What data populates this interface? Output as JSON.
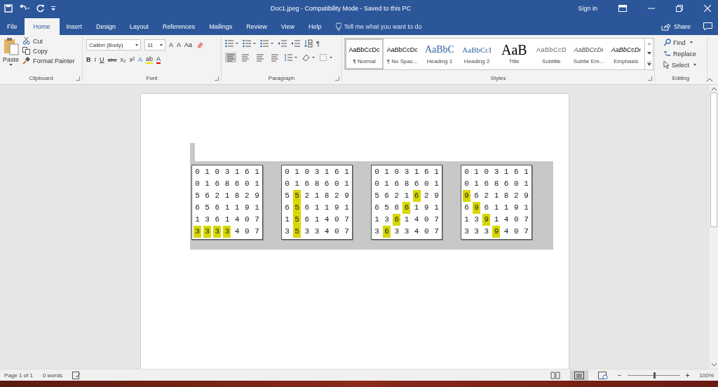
{
  "window": {
    "title": "Doc1.jpeg  -  Compatibility Mode  -  Saved to this PC",
    "sign_in": "Sign in"
  },
  "tabs": [
    {
      "label": "File",
      "selected": false
    },
    {
      "label": "Home",
      "selected": true
    },
    {
      "label": "Insert",
      "selected": false
    },
    {
      "label": "Design",
      "selected": false
    },
    {
      "label": "Layout",
      "selected": false
    },
    {
      "label": "References",
      "selected": false
    },
    {
      "label": "Mailings",
      "selected": false
    },
    {
      "label": "Review",
      "selected": false
    },
    {
      "label": "View",
      "selected": false
    },
    {
      "label": "Help",
      "selected": false
    }
  ],
  "tell_me": {
    "placeholder": "Tell me what you want to do"
  },
  "share": "Share",
  "clipboard": {
    "paste": "Paste",
    "items": [
      "Cut",
      "Copy",
      "Format Painter"
    ],
    "label": "Clipboard"
  },
  "font": {
    "family": "Calibri (Body)",
    "size": "11",
    "row1": [
      "A",
      "A",
      "Aa"
    ],
    "row2": [
      "B",
      "I",
      "U",
      "abc",
      "x₂",
      "x²",
      "A",
      "ab",
      "A"
    ],
    "label": "Font"
  },
  "paragraph": {
    "pilcrow": "¶",
    "label": "Paragraph"
  },
  "styles": {
    "label": "Styles",
    "items": [
      {
        "preview": "AaBbCcDc",
        "name": "¶ Normal",
        "kind": "body",
        "selected": true
      },
      {
        "preview": "AaBbCcDc",
        "name": "¶ No Spac...",
        "kind": "body",
        "selected": false
      },
      {
        "preview": "AaBbC",
        "name": "Heading 1",
        "kind": "heading1",
        "selected": false
      },
      {
        "preview": "AaBbCcI",
        "name": "Heading 2",
        "kind": "heading2",
        "selected": false
      },
      {
        "preview": "AaB",
        "name": "Title",
        "kind": "title",
        "selected": false
      },
      {
        "preview": "AaBbCcD",
        "name": "Subtitle",
        "kind": "subtitle",
        "selected": false
      },
      {
        "preview": "AaBbCcDı",
        "name": "Subtle Em...",
        "kind": "subtle",
        "selected": false
      },
      {
        "preview": "AaBbCcDı",
        "name": "Emphasis",
        "kind": "emphasis",
        "selected": false
      }
    ]
  },
  "editing": {
    "items": [
      "Find",
      "Replace",
      "Select"
    ],
    "label": "Editing"
  },
  "grids": [
    {
      "rows": [
        {
          "cells": [
            "0",
            "1",
            "0",
            "3",
            "1",
            "6",
            "1"
          ],
          "highlighted": [
            false,
            false,
            false,
            false,
            false,
            false,
            false
          ]
        },
        {
          "cells": [
            "0",
            "1",
            "6",
            "8",
            "6",
            "0",
            "1"
          ],
          "highlighted": [
            false,
            false,
            false,
            false,
            false,
            false,
            false
          ]
        },
        {
          "cells": [
            "5",
            "6",
            "2",
            "1",
            "8",
            "2",
            "9"
          ],
          "highlighted": [
            false,
            false,
            false,
            false,
            false,
            false,
            false
          ]
        },
        {
          "cells": [
            "6",
            "5",
            "6",
            "1",
            "1",
            "9",
            "1"
          ],
          "highlighted": [
            false,
            false,
            false,
            false,
            false,
            false,
            false
          ]
        },
        {
          "cells": [
            "1",
            "3",
            "6",
            "1",
            "4",
            "0",
            "7"
          ],
          "highlighted": [
            false,
            false,
            false,
            false,
            false,
            false,
            false
          ]
        },
        {
          "cells": [
            "3",
            "3",
            "3",
            "3",
            "4",
            "0",
            "7"
          ],
          "highlighted": [
            true,
            true,
            true,
            true,
            false,
            false,
            false
          ]
        }
      ]
    },
    {
      "rows": [
        {
          "cells": [
            "0",
            "1",
            "0",
            "3",
            "1",
            "6",
            "1"
          ],
          "highlighted": [
            false,
            false,
            false,
            false,
            false,
            false,
            false
          ]
        },
        {
          "cells": [
            "0",
            "1",
            "6",
            "8",
            "6",
            "0",
            "1"
          ],
          "highlighted": [
            false,
            false,
            false,
            false,
            false,
            false,
            false
          ]
        },
        {
          "cells": [
            "5",
            "5",
            "2",
            "1",
            "8",
            "2",
            "9"
          ],
          "highlighted": [
            false,
            true,
            false,
            false,
            false,
            false,
            false
          ]
        },
        {
          "cells": [
            "6",
            "5",
            "6",
            "1",
            "1",
            "9",
            "1"
          ],
          "highlighted": [
            false,
            true,
            false,
            false,
            false,
            false,
            false
          ]
        },
        {
          "cells": [
            "1",
            "5",
            "6",
            "1",
            "4",
            "0",
            "7"
          ],
          "highlighted": [
            false,
            true,
            false,
            false,
            false,
            false,
            false
          ]
        },
        {
          "cells": [
            "3",
            "5",
            "3",
            "3",
            "4",
            "0",
            "7"
          ],
          "highlighted": [
            false,
            true,
            false,
            false,
            false,
            false,
            false
          ]
        }
      ]
    },
    {
      "rows": [
        {
          "cells": [
            "0",
            "1",
            "0",
            "3",
            "1",
            "6",
            "1"
          ],
          "highlighted": [
            false,
            false,
            false,
            false,
            false,
            false,
            false
          ]
        },
        {
          "cells": [
            "0",
            "1",
            "6",
            "8",
            "6",
            "0",
            "1"
          ],
          "highlighted": [
            false,
            false,
            false,
            false,
            false,
            false,
            false
          ]
        },
        {
          "cells": [
            "5",
            "6",
            "2",
            "1",
            "6",
            "2",
            "9"
          ],
          "highlighted": [
            false,
            false,
            false,
            false,
            true,
            false,
            false
          ]
        },
        {
          "cells": [
            "6",
            "5",
            "6",
            "6",
            "1",
            "9",
            "1"
          ],
          "highlighted": [
            false,
            false,
            false,
            true,
            false,
            false,
            false
          ]
        },
        {
          "cells": [
            "1",
            "3",
            "6",
            "1",
            "4",
            "0",
            "7"
          ],
          "highlighted": [
            false,
            false,
            true,
            false,
            false,
            false,
            false
          ]
        },
        {
          "cells": [
            "3",
            "6",
            "3",
            "3",
            "4",
            "0",
            "7"
          ],
          "highlighted": [
            false,
            true,
            false,
            false,
            false,
            false,
            false
          ]
        }
      ]
    },
    {
      "rows": [
        {
          "cells": [
            "0",
            "1",
            "0",
            "3",
            "1",
            "6",
            "1"
          ],
          "highlighted": [
            false,
            false,
            false,
            false,
            false,
            false,
            false
          ]
        },
        {
          "cells": [
            "0",
            "1",
            "6",
            "8",
            "6",
            "0",
            "1"
          ],
          "highlighted": [
            false,
            false,
            false,
            false,
            false,
            false,
            false
          ]
        },
        {
          "cells": [
            "9",
            "6",
            "2",
            "1",
            "8",
            "2",
            "9"
          ],
          "highlighted": [
            true,
            false,
            false,
            false,
            false,
            false,
            false
          ]
        },
        {
          "cells": [
            "6",
            "9",
            "6",
            "1",
            "1",
            "9",
            "1"
          ],
          "highlighted": [
            false,
            true,
            false,
            false,
            false,
            false,
            false
          ]
        },
        {
          "cells": [
            "1",
            "3",
            "9",
            "1",
            "4",
            "0",
            "7"
          ],
          "highlighted": [
            false,
            false,
            true,
            false,
            false,
            false,
            false
          ]
        },
        {
          "cells": [
            "3",
            "3",
            "3",
            "9",
            "4",
            "0",
            "7"
          ],
          "highlighted": [
            false,
            false,
            false,
            true,
            false,
            false,
            false
          ]
        }
      ]
    }
  ],
  "status_bar": {
    "page": "Page 1 of 1",
    "words": "0 words",
    "zoom": "100%",
    "zoom_out": "−",
    "zoom_in": "+",
    "zoom_slider": {
      "level": 0.5
    }
  }
}
